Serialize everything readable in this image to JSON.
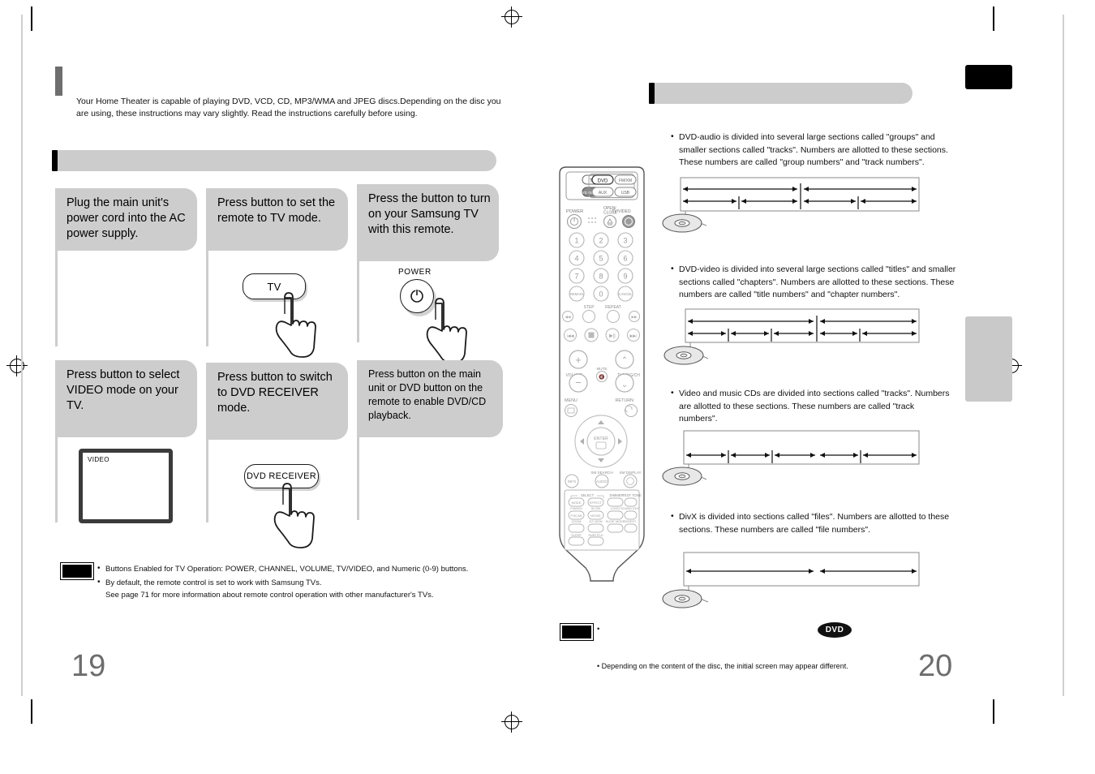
{
  "document": {
    "left_page_number": "19",
    "right_page_number": "20"
  },
  "intro": {
    "text": "Your Home Theater is capable of playing DVD, VCD, CD, MP3/WMA  and JPEG discs.Depending on the disc you are using, these instructions may vary slightly. Read the instructions carefully before using."
  },
  "left_section_header": {
    "label": ""
  },
  "right_section_header": {
    "label": ""
  },
  "steps": [
    {
      "id": "step-1",
      "text": "Plug the main unit's power cord into the AC power supply.",
      "illustration": "none",
      "button_label": ""
    },
    {
      "id": "step-2",
      "text": "Press        button to set the remote to TV mode.",
      "illustration": "pill-button",
      "button_label": "TV"
    },
    {
      "id": "step-3",
      "text": "Press the button to turn on your Samsung TV with this remote.",
      "illustration": "power-button",
      "button_label": "POWER"
    },
    {
      "id": "step-4",
      "text": "Press button to select VIDEO mode on your TV.",
      "illustration": "tv-screen",
      "button_label": "VIDEO"
    },
    {
      "id": "step-5",
      "text": "Press button to switch to DVD RECEIVER mode.",
      "illustration": "pill-button",
      "button_label": "DVD RECEIVER"
    },
    {
      "id": "step-6",
      "text": "Press              button on the main unit or DVD button on the remote to enable DVD/CD playback.",
      "illustration": "none",
      "button_label": ""
    }
  ],
  "left_notes": {
    "badge": "",
    "items": [
      "Buttons Enabled for TV Operation: POWER, CHANNEL, VOLUME, TV/VIDEO, and Numeric (0-9) buttons.",
      "By default, the remote control is set to work with Samsung TVs."
    ],
    "sub_item": "See page 71 for more information about remote control operation with other manufacturer's TVs."
  },
  "right_bullets": [
    {
      "id": "dvd-audio",
      "text": "DVD-audio is divided into several large sections called \"groups\" and smaller sections called \"tracks\". Numbers are allotted to these sections. These numbers are called \"group numbers\" and \"track numbers\"."
    },
    {
      "id": "dvd-video",
      "text": "DVD-video is divided into several large sections called \"titles\" and smaller sections called \"chapters\". Numbers are allotted to these sections. These numbers are called \"title numbers\" and \"chapter numbers\"."
    },
    {
      "id": "cd",
      "text": "Video and music CDs are divided into sections called \"tracks\". Numbers are allotted to these sections. These numbers are called \"track numbers\"."
    },
    {
      "id": "divx",
      "text": "DivX is divided into sections called \"files\". Numbers are allotted to these sections. These numbers are called \"file numbers\"."
    }
  ],
  "diagrams": [
    {
      "id": "diagram-dvd-audio",
      "rows": 2,
      "top_segments": 2,
      "bottom_segments": 4
    },
    {
      "id": "diagram-dvd-video",
      "rows": 2,
      "top_segments": 2,
      "bottom_segments": 4
    },
    {
      "id": "diagram-cd",
      "rows": 1,
      "top_segments": 0,
      "bottom_segments": 4
    },
    {
      "id": "diagram-divx",
      "rows": 1,
      "top_segments": 0,
      "bottom_segments": 2
    }
  ],
  "right_notes": {
    "badge": "",
    "bullet": "•",
    "chip": "DVD",
    "footnote": "Depending on the content of the disc, the initial screen may appear different."
  },
  "remote": {
    "source_buttons": [
      "TV",
      "DVD",
      "FM/XM",
      "DVD RECEIVER",
      "AUX",
      "USB"
    ],
    "labels_row1": [
      "POWER",
      "OPEN/ CLOSE",
      "TV/VIDEO"
    ],
    "numeric_keys": [
      "1",
      "2",
      "3",
      "4",
      "5",
      "6",
      "7",
      "8",
      "9"
    ],
    "numeric_row4": [
      "REMAIN",
      "0",
      "CANCEL"
    ],
    "labels_step_repeat": [
      "STEP",
      "REPEAT"
    ],
    "volume_label": "VOLUME",
    "mute_label": "MUTE",
    "tuning_label": "TUNING/CH",
    "menu_label": "MENU",
    "return_label": "RETURN",
    "enter_label": "ENTER",
    "bottom_labels": [
      "INFO",
      "XM SEARCH",
      "AUDIO",
      "XM DISPLAY"
    ],
    "grid_labels": [
      "SELECT",
      "MODE",
      "EFFECT",
      "DIMMER",
      "TEST TONE",
      "P.BASS/ SPEAKER",
      "SLOW",
      "LOGO",
      "SOUND EDIT",
      "P.SCAN",
      "MOVIE",
      "ZOOM",
      "EZ VIEW",
      "SLIDE MODE",
      "DIGEST",
      "SLEEP",
      "SUBTITLE"
    ]
  }
}
